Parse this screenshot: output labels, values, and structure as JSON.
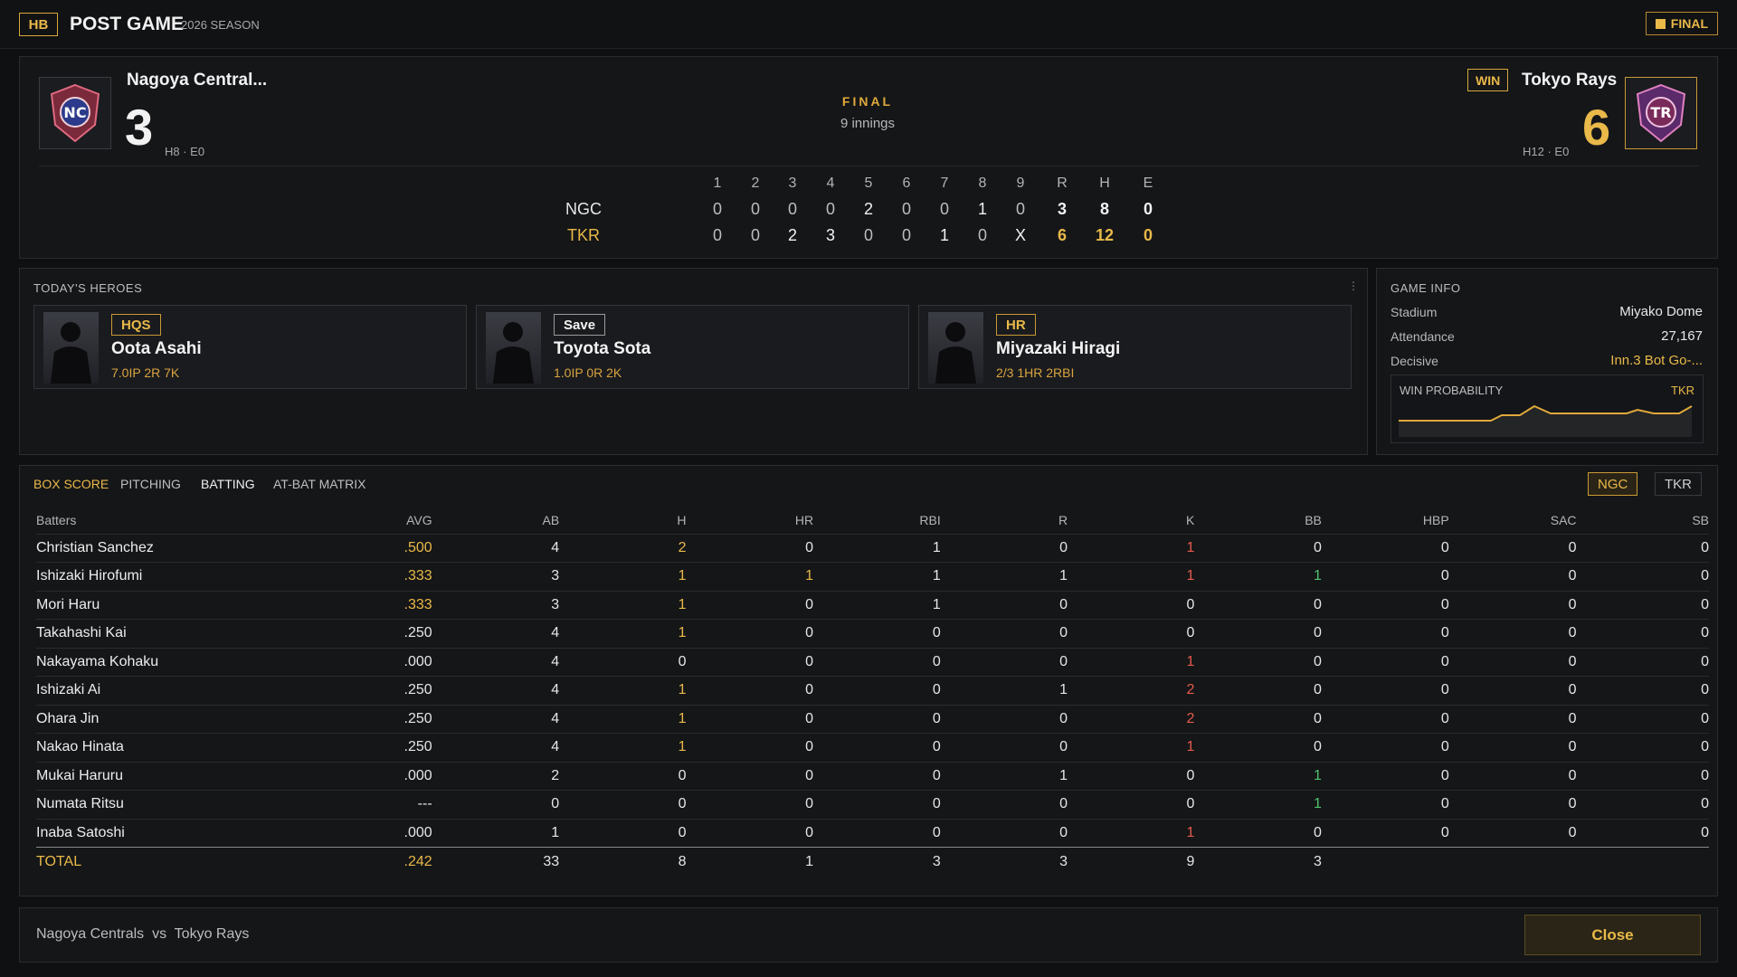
{
  "topbar": {
    "badge": "HB",
    "title": "POST GAME",
    "season": "2026 SEASON",
    "status": "FINAL"
  },
  "away": {
    "name": "Nagoya Central...",
    "score": "3",
    "stats": "H8 · E0",
    "abbr": "NGC"
  },
  "home": {
    "name": "Tokyo Rays",
    "score": "6",
    "stats": "H12 · E0",
    "abbr": "TKR",
    "result": "WIN"
  },
  "game": {
    "status": "FINAL",
    "innings": "9 innings"
  },
  "linescore": {
    "headers": [
      "1",
      "2",
      "3",
      "4",
      "5",
      "6",
      "7",
      "8",
      "9",
      "R",
      "H",
      "E"
    ],
    "rows": [
      {
        "team": "NGC",
        "cells": [
          "0",
          "0",
          "0",
          "0",
          "2",
          "0",
          "0",
          "1",
          "0",
          "3",
          "8",
          "0"
        ]
      },
      {
        "team": "TKR",
        "cells": [
          "0",
          "0",
          "2",
          "3",
          "0",
          "0",
          "1",
          "0",
          "X",
          "6",
          "12",
          "0"
        ]
      }
    ]
  },
  "heroes": {
    "label": "TODAY'S HEROES",
    "more": "⋮",
    "cards": [
      {
        "tag": "HQS",
        "name": "Oota Asahi",
        "stat": "7.0IP 2R 7K"
      },
      {
        "tag": "Save",
        "name": "Toyota Sota",
        "stat": "1.0IP 0R 2K"
      },
      {
        "tag": "HR",
        "name": "Miyazaki Hiragi",
        "stat": "2/3 1HR 2RBI"
      }
    ]
  },
  "game_info": {
    "label": "GAME INFO",
    "rows": [
      {
        "k": "Stadium",
        "v": "Miyako Dome"
      },
      {
        "k": "Attendance",
        "v": "27,167"
      },
      {
        "k": "Decisive",
        "v": "Inn.3 Bot Go-..."
      }
    ],
    "win_prob_label": "WIN PROBABILITY",
    "win_prob_team": "TKR"
  },
  "tabs": [
    {
      "label": "BOX SCORE"
    },
    {
      "label": "PITCHING"
    },
    {
      "label": "BATTING"
    },
    {
      "label": "AT-BAT MATRIX"
    }
  ],
  "team_toggle": [
    "NGC",
    "TKR"
  ],
  "batting": {
    "headers": [
      "Batters",
      "AVG",
      "AB",
      "H",
      "HR",
      "RBI",
      "R",
      "K",
      "BB",
      "HBP",
      "SAC",
      "SB"
    ],
    "rows": [
      [
        "Christian Sanchez",
        ".500",
        "4",
        "2",
        "0",
        "1",
        "0",
        "1",
        "0",
        "0",
        "0",
        "0"
      ],
      [
        "Ishizaki Hirofumi",
        ".333",
        "3",
        "1",
        "1",
        "1",
        "1",
        "1",
        "1",
        "0",
        "0",
        "0"
      ],
      [
        "Mori Haru",
        ".333",
        "3",
        "1",
        "0",
        "1",
        "0",
        "0",
        "0",
        "0",
        "0",
        "0"
      ],
      [
        "Takahashi Kai",
        ".250",
        "4",
        "1",
        "0",
        "0",
        "0",
        "0",
        "0",
        "0",
        "0",
        "0"
      ],
      [
        "Nakayama Kohaku",
        ".000",
        "4",
        "0",
        "0",
        "0",
        "0",
        "1",
        "0",
        "0",
        "0",
        "0"
      ],
      [
        "Ishizaki Ai",
        ".250",
        "4",
        "1",
        "0",
        "0",
        "1",
        "2",
        "0",
        "0",
        "0",
        "0"
      ],
      [
        "Ohara Jin",
        ".250",
        "4",
        "1",
        "0",
        "0",
        "0",
        "2",
        "0",
        "0",
        "0",
        "0"
      ],
      [
        "Nakao Hinata",
        ".250",
        "4",
        "1",
        "0",
        "0",
        "0",
        "1",
        "0",
        "0",
        "0",
        "0"
      ],
      [
        "Mukai Haruru",
        ".000",
        "2",
        "0",
        "0",
        "0",
        "1",
        "0",
        "1",
        "0",
        "0",
        "0"
      ],
      [
        "Numata Ritsu",
        "---",
        "0",
        "0",
        "0",
        "0",
        "0",
        "0",
        "1",
        "0",
        "0",
        "0"
      ],
      [
        "Inaba Satoshi",
        ".000",
        "1",
        "0",
        "0",
        "0",
        "0",
        "1",
        "0",
        "0",
        "0",
        "0"
      ]
    ],
    "total": [
      "TOTAL",
      ".242",
      "33",
      "8",
      "1",
      "3",
      "3",
      "9",
      "3",
      "",
      "",
      ""
    ]
  },
  "footer": {
    "matchup": "Nagoya Centrals  vs  Tokyo Rays",
    "close_label": "Close"
  },
  "colors": {
    "accent": "#e9b949",
    "red": "#e55b4c",
    "green": "#4fc46a",
    "bg": "#0f1012"
  }
}
